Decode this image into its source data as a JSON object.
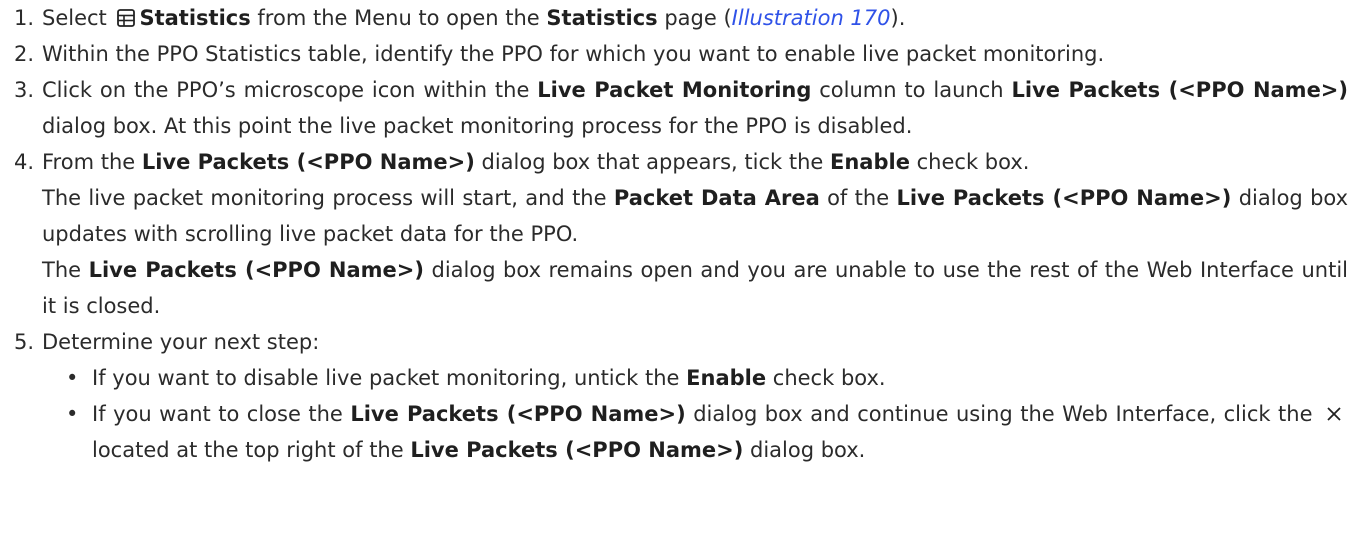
{
  "steps": [
    {
      "num": "1.",
      "t1": "Select ",
      "icon": "table-grid-icon",
      "b1": "Statistics",
      "t2": " from the Menu to open the ",
      "b2": "Statistics",
      "t3": " page (",
      "link": "Illustration 170",
      "t4": ")."
    },
    {
      "num": "2.",
      "text": "Within the PPO Statistics table, identify the PPO for which you want to enable live packet monitoring."
    },
    {
      "num": "3.",
      "t1": "Click on the PPO’s microscope icon within the ",
      "b1": "Live Packet Monitoring",
      "t2": " column to launch ",
      "b2": "Live Packets (<PPO Name>)",
      "t3": " dialog box. At this point the live packet monitoring process for the PPO is disabled."
    },
    {
      "num": "4.",
      "t1": "From the ",
      "b1": "Live Packets (<PPO Name>)",
      "t2": " dialog box that appears, tick the ",
      "b2": "Enable",
      "t3": " check box.",
      "p2": {
        "t1": "The live packet monitoring process will start, and the ",
        "b1": "Packet Data Area",
        "t2": " of the ",
        "b2": "Live Packets (<PPO Name>)",
        "t3": " dialog box updates with scrolling live packet data for the PPO."
      },
      "p3": {
        "t1": "The ",
        "b1": "Live Packets (<PPO Name>)",
        "t2": " dialog box remains open and you are unable to use the rest of the Web Interface until it is closed."
      }
    },
    {
      "num": "5.",
      "text": "Determine your next step:",
      "bullets": [
        {
          "bullet": "•",
          "t1": "If you want to disable live packet monitoring, untick the ",
          "b1": "Enable",
          "t2": " check box."
        },
        {
          "bullet": "•",
          "t1": "If you want to close the ",
          "b1": "Live Packets (<PPO Name>)",
          "t2": " dialog box and continue using the Web Interface, click the ",
          "icon": "close-x-icon",
          "t3": " located at the top right of the ",
          "b2": "Live Packets (<PPO Name>)",
          "t4": " dialog box."
        }
      ]
    }
  ]
}
